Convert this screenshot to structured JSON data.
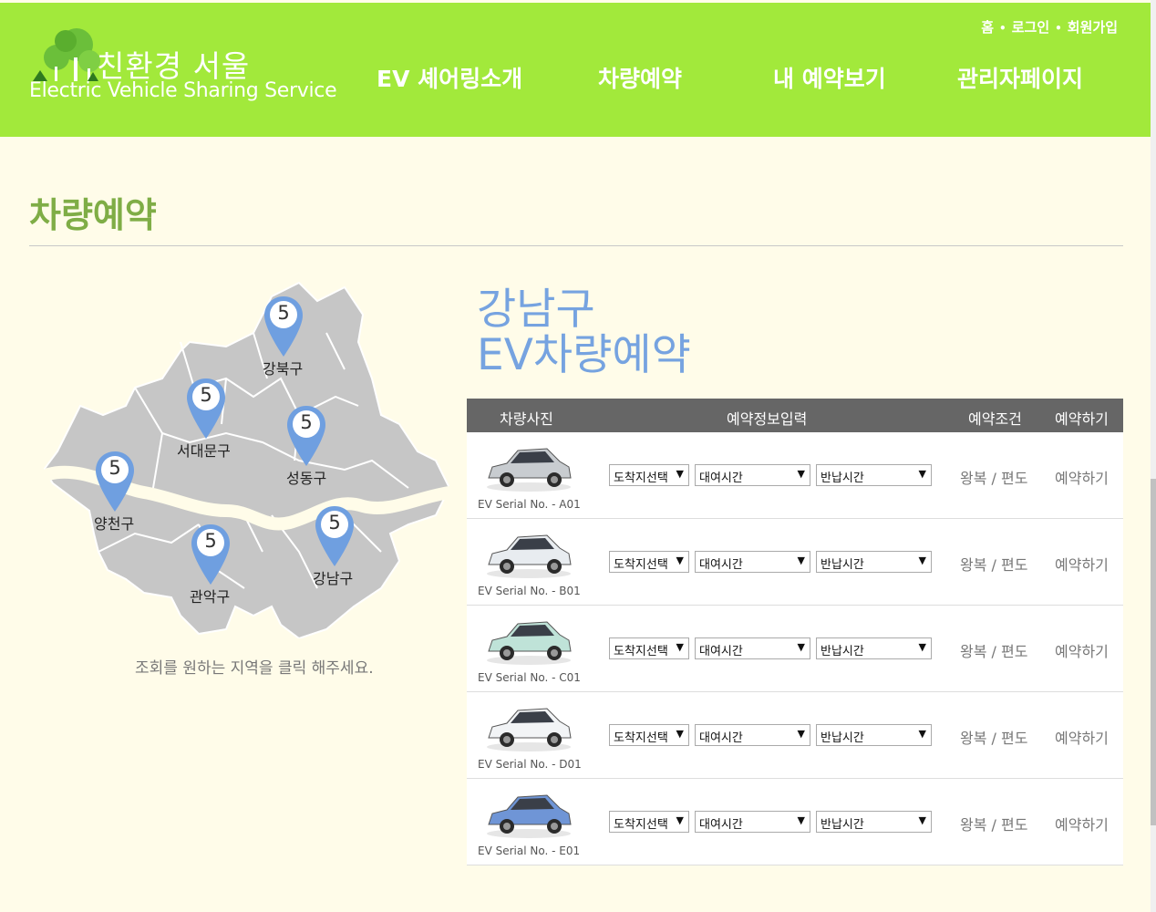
{
  "header": {
    "logo_title": "친환경 서울",
    "logo_sub": "Electric Vehicle Sharing Service",
    "util": [
      "홈",
      "로그인",
      "회원가입"
    ],
    "util_sep": "•",
    "nav": [
      "EV 셰어링소개",
      "차량예약",
      "내 예약보기",
      "관리자페이지"
    ]
  },
  "page": {
    "title": "차량예약"
  },
  "map": {
    "hint": "조회를 원하는 지역을 클릭 해주세요.",
    "markers": [
      {
        "count": "5",
        "district": "강북구"
      },
      {
        "count": "5",
        "district": "서대문구"
      },
      {
        "count": "5",
        "district": "성동구"
      },
      {
        "count": "5",
        "district": "양천구"
      },
      {
        "count": "5",
        "district": "관악구"
      },
      {
        "count": "5",
        "district": "강남구"
      }
    ],
    "marker_color": "#6f9fe0"
  },
  "reservation": {
    "district": "강남구",
    "subtitle": "EV차량예약",
    "columns": [
      "차량사진",
      "예약정보입력",
      "예약조건",
      "예약하기"
    ],
    "rows": [
      {
        "serial": "EV Serial No. - A01",
        "dest": "도착지선택",
        "rent": "대여시간",
        "ret": "반납시간",
        "cond": "왕복 / 편도",
        "action": "예약하기",
        "car_color": "#c8ccd0"
      },
      {
        "serial": "EV Serial No. - B01",
        "dest": "도착지선택",
        "rent": "대여시간",
        "ret": "반납시간",
        "cond": "왕복 / 편도",
        "action": "예약하기",
        "car_color": "#e8ecf0"
      },
      {
        "serial": "EV Serial No. - C01",
        "dest": "도착지선택",
        "rent": "대여시간",
        "ret": "반납시간",
        "cond": "왕복 / 편도",
        "action": "예약하기",
        "car_color": "#bfe3d8"
      },
      {
        "serial": "EV Serial No. - D01",
        "dest": "도착지선택",
        "rent": "대여시간",
        "ret": "반납시간",
        "cond": "왕복 / 편도",
        "action": "예약하기",
        "car_color": "#f2f4f6"
      },
      {
        "serial": "EV Serial No. - E01",
        "dest": "도착지선택",
        "rent": "대여시간",
        "ret": "반납시간",
        "cond": "왕복 / 편도",
        "action": "예약하기",
        "car_color": "#6f95d6"
      }
    ]
  },
  "colors": {
    "header_bg": "#a2e93b",
    "title_green": "#7fad46",
    "page_bg": "#fffce9",
    "accent_blue": "#76a3e0"
  }
}
